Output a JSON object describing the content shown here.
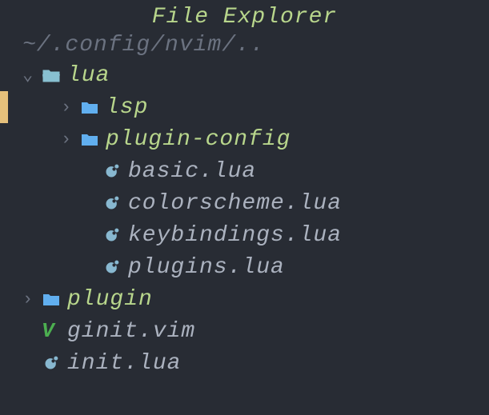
{
  "title": "File Explorer",
  "path": "~/.config/nvim/..",
  "tree": {
    "lua": {
      "label": "lua",
      "lsp": {
        "label": "lsp"
      },
      "plugin_config": {
        "label": "plugin-config"
      },
      "basic": {
        "label": "basic.lua"
      },
      "colorscheme": {
        "label": "colorscheme.lua"
      },
      "keybindings": {
        "label": "keybindings.lua"
      },
      "plugins": {
        "label": "plugins.lua"
      }
    },
    "plugin": {
      "label": "plugin"
    },
    "ginit": {
      "label": "ginit.vim"
    },
    "init": {
      "label": "init.lua"
    }
  }
}
